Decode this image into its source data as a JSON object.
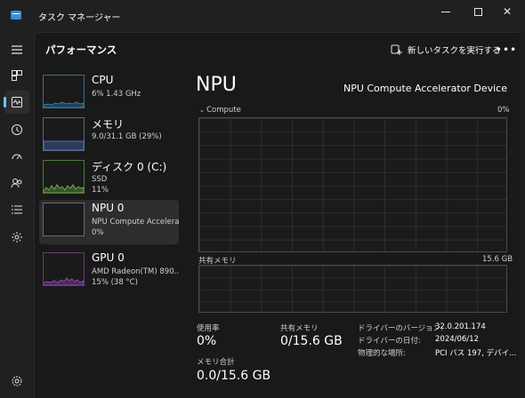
{
  "window": {
    "title": "タスク マネージャー"
  },
  "header": {
    "page_title": "パフォーマンス",
    "run_task_label": "新しいタスクを実行する",
    "more_label": "•••"
  },
  "nav": {
    "items": [
      {
        "name": "menu-icon"
      },
      {
        "name": "processes-icon"
      },
      {
        "name": "performance-icon"
      },
      {
        "name": "app-history-icon"
      },
      {
        "name": "startup-apps-icon"
      },
      {
        "name": "users-icon"
      },
      {
        "name": "details-icon"
      },
      {
        "name": "services-icon"
      },
      {
        "name": "settings-icon"
      }
    ],
    "active_index": 2
  },
  "devices": [
    {
      "name": "CPU",
      "line1": "6% 1.43 GHz",
      "line2": ""
    },
    {
      "name": "メモリ",
      "line1": "9.0/31.1 GB (29%)",
      "line2": ""
    },
    {
      "name": "ディスク 0 (C:)",
      "line1": "SSD",
      "line2": "11%"
    },
    {
      "name": "NPU 0",
      "line1": "NPU Compute Accelera...",
      "line2": "0%"
    },
    {
      "name": "GPU 0",
      "line1": "AMD Radeon(TM) 890...",
      "line2": "15% (38 °C)"
    }
  ],
  "detail": {
    "title": "NPU",
    "device_name": "NPU Compute Accelerator Device",
    "compute_label": "Compute",
    "compute_max": "0%",
    "shared_label": "共有メモリ",
    "shared_max": "15.6 GB",
    "stats": {
      "usage_label": "使用率",
      "usage_value": "0%",
      "shared_label": "共有メモリ",
      "shared_value": "0/15.6 GB",
      "total_label": "メモリ合計",
      "total_value": "0.0/15.6 GB"
    },
    "info": [
      {
        "key": "ドライバーのバージョン:",
        "value": "32.0.201.174"
      },
      {
        "key": "ドライバーの日付:",
        "value": "2024/06/12"
      },
      {
        "key": "物理的な場所:",
        "value": "PCI バス 197, デバイ..."
      }
    ]
  },
  "colors": {
    "accent": "#60cdff",
    "cpu": "#3c8fc7",
    "memory": "#6a86c9",
    "disk": "#7fbf4a",
    "gpu": "#a24fd0"
  }
}
